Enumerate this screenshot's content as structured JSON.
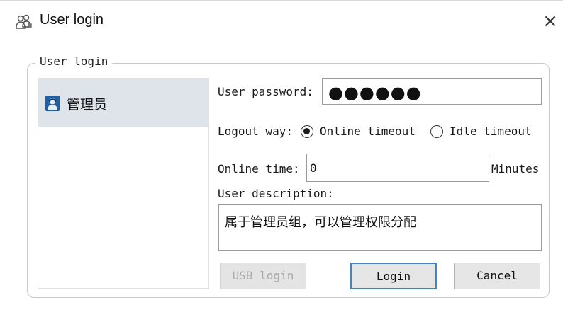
{
  "window": {
    "title": "User login",
    "icon": "users-icon",
    "close_glyph": "×"
  },
  "group": {
    "legend": "User login"
  },
  "user_list": {
    "items": [
      {
        "label": "管理员",
        "icon": "admin-user-icon",
        "selected": true
      }
    ]
  },
  "form": {
    "password_label": "User password:",
    "password_mask": "●●●●●●",
    "logout_label": "Logout way:",
    "logout_options": [
      {
        "label": "Online timeout",
        "checked": true
      },
      {
        "label": "Idle timeout",
        "checked": false
      }
    ],
    "online_time_label": "Online time:",
    "online_time_value": "0",
    "online_time_unit": "Minutes",
    "description_label": "User description:",
    "description_value": "属于管理员组，可以管理权限分配"
  },
  "buttons": {
    "usb_login": "USB login",
    "login": "Login",
    "cancel": "Cancel"
  },
  "colors": {
    "selected_item_bg": "#dfe3ea",
    "default_button_border": "#3f84c5",
    "admin_icon": "#1f5fa8"
  }
}
